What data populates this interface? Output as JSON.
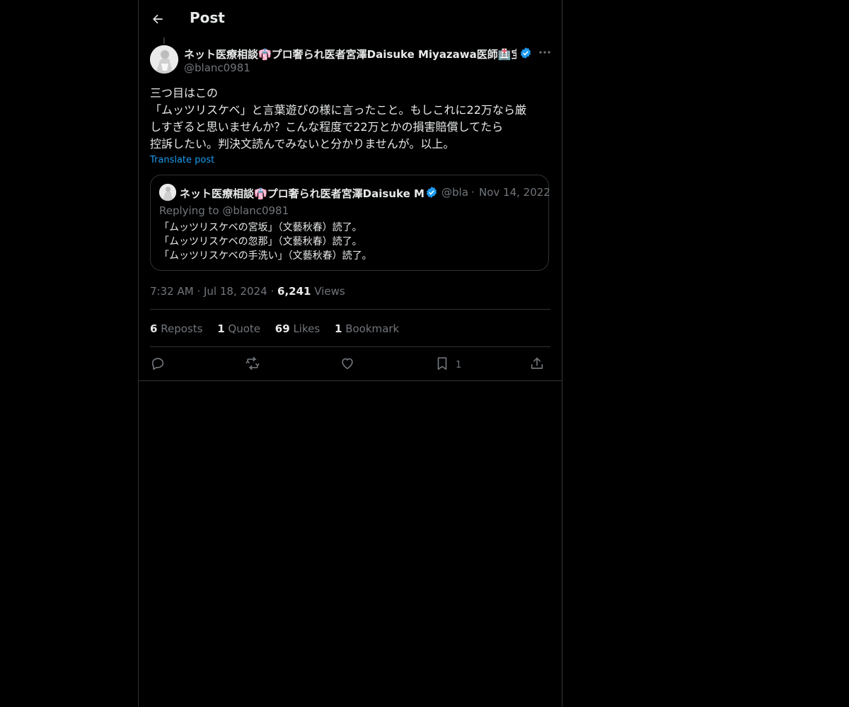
{
  "header": {
    "title": "Post"
  },
  "post": {
    "author_name": "ネット医療相談👘プロ奢られ医者宮澤Daisuke Miyazawa医師🏥宝塚",
    "handle": "@blanc0981",
    "text_lines": [
      "三つ目はこの",
      "「ムッツリスケベ」と言葉遊びの様に言ったこと。もしこれに22万なら厳",
      "しすぎると思いませんか？こんな程度で22万とかの損害賠償してたら",
      "控訴したい。判決文読んでみないと分かりませんが。以上。"
    ],
    "translate_label": "Translate post",
    "time": "7:32 AM",
    "date": "Jul 18, 2024",
    "views_count": "6,241",
    "views_label": "Views",
    "sep": "·"
  },
  "quote": {
    "author_name": "ネット医療相談👘プロ奢られ医者宮澤Daisuke Miy",
    "handle": "@bla",
    "date": "Nov 14, 2022",
    "sep": "·",
    "replying_to": "Replying to @blanc0981",
    "text_lines": [
      "「ムッツリスケベの宮坂」（文藝秋春）読了。",
      "「ムッツリスケベの忽那」（文藝秋春）読了。",
      "「ムッツリスケベの手洗い」（文藝秋春）読了。"
    ]
  },
  "stats": {
    "reposts_count": "6",
    "reposts_label": "Reposts",
    "quotes_count": "1",
    "quotes_label": "Quote",
    "likes_count": "69",
    "likes_label": "Likes",
    "bookmarks_count": "1",
    "bookmarks_label": "Bookmark"
  },
  "actions": {
    "bookmark_count": "1",
    "icons": [
      "reply-icon",
      "repost-icon",
      "like-icon",
      "bookmark-icon",
      "share-icon"
    ]
  },
  "colors": {
    "background": "#000000",
    "text": "#e7e9ea",
    "muted": "#71767b",
    "accent": "#1d9bf0",
    "border": "#2f3336"
  }
}
